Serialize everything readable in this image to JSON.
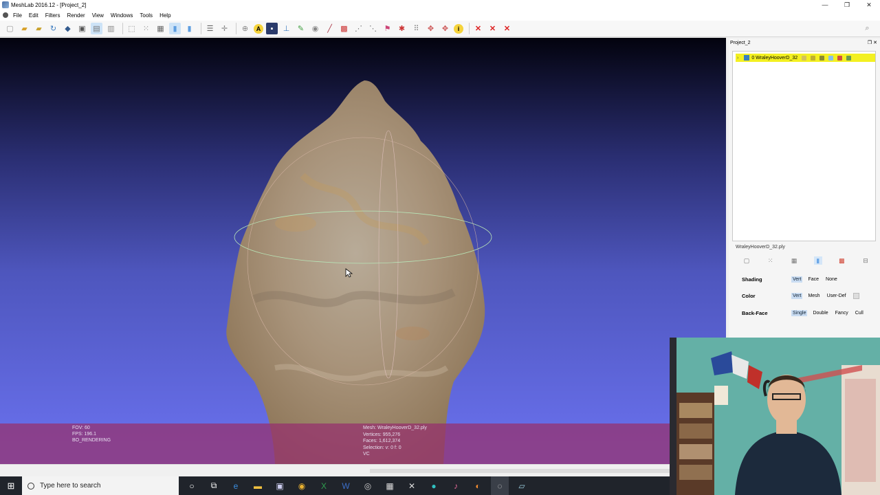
{
  "window": {
    "title": "MeshLab 2016.12 - [Project_2]",
    "buttons": [
      "—",
      "❐",
      "✕"
    ]
  },
  "menu": {
    "items": [
      "File",
      "Edit",
      "Filters",
      "Render",
      "View",
      "Windows",
      "Tools",
      "Help"
    ]
  },
  "toolbar": {
    "icons": [
      "new-project-icon",
      "open-icon",
      "save-icon",
      "reload-icon",
      "import-icon",
      "snapshot-icon",
      "layers-icon",
      "box-icon",
      "points-icon",
      "wireframe-icon",
      "flat-icon",
      "smooth-icon",
      "texture-icon",
      "light-icon",
      "fancy-lighting-icon",
      "annotate-icon",
      "info-icon",
      "cube-icon",
      "measure-icon",
      "pick-icon",
      "paint-icon",
      "select-faces-icon",
      "select-vertices-icon",
      "move-icon",
      "align-icon",
      "manipulator-icon",
      "flatten-icon",
      "glyph-icon",
      "help-icon",
      "delete-icon",
      "delete-faces-icon",
      "delete-vertices-icon"
    ]
  },
  "viewport": {
    "info_left": [
      "FOV: 60",
      "FPS:  196.1",
      "BO_RENDERING"
    ],
    "info_mid": [
      "Mesh: WraleyHooverD_32.ply",
      "Vertices: 955,276",
      "Faces: 1,612,374",
      "Selection: v: 0 f: 0",
      "VC"
    ]
  },
  "panel": {
    "title": "Project_2",
    "layer_label": "0  WraleyHooverD_32",
    "mesh_file": "WraleyHooverD_32.ply",
    "shading": {
      "label": "Shading",
      "options": [
        "Vert",
        "Face",
        "None"
      ]
    },
    "color": {
      "label": "Color",
      "options": [
        "Vert",
        "Mesh",
        "User-Def"
      ]
    },
    "backface": {
      "label": "Back-Face",
      "options": [
        "Single",
        "Double",
        "Fancy",
        "Cull"
      ]
    }
  },
  "taskbar": {
    "search_placeholder": "Type here to search"
  },
  "colors": {
    "layer_highlight": "#f3f021",
    "overlay": "#96326e",
    "viewport_top": "#03030e",
    "viewport_bottom": "#6b72f0"
  }
}
